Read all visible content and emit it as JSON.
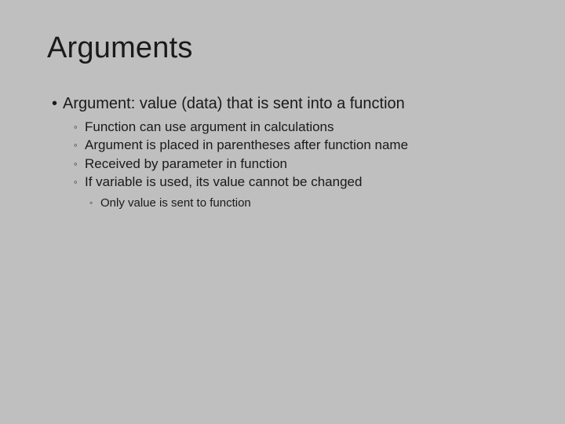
{
  "slide": {
    "title": "Arguments",
    "main_point": "Argument: value (data) that is sent into a function",
    "sub_points": [
      "Function can use argument in calculations",
      "Argument is placed in parentheses after function name",
      "Received by parameter in function",
      "If variable is used, its value cannot be changed"
    ],
    "sub_sub_point": "Only value is sent to function"
  }
}
